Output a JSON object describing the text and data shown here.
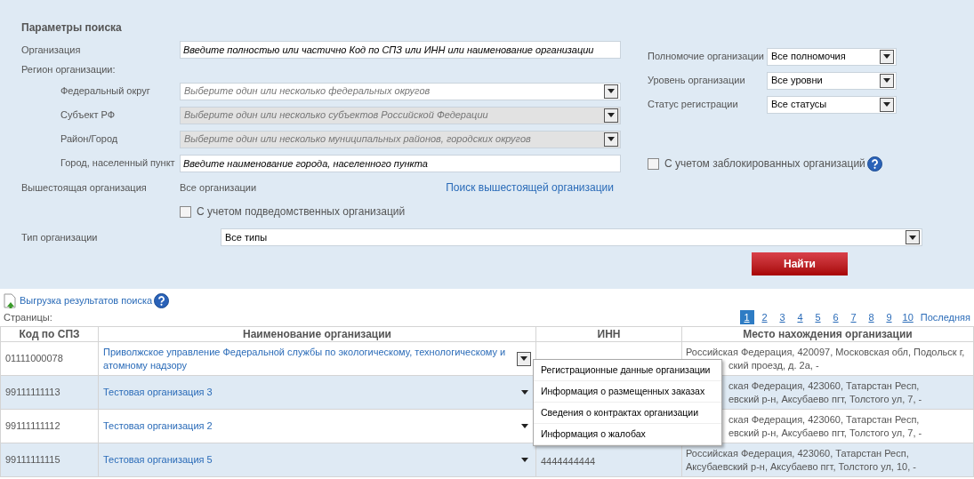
{
  "search_panel": {
    "title": "Параметры поиска",
    "organization": {
      "label": "Организация",
      "placeholder": "Введите полностью или частично Код по СПЗ или ИНН или наименование организации"
    },
    "region_label": "Регион организации:",
    "region_fields": [
      {
        "label": "Федеральный округ",
        "placeholder": "Выберите один или несколько федеральных округов",
        "disabled": false
      },
      {
        "label": "Субъект РФ",
        "placeholder": "Выберите один или несколько субъектов Российской Федерации",
        "disabled": true
      },
      {
        "label": "Район/Город",
        "placeholder": "Выберите один или несколько муниципальных районов, городских округов",
        "disabled": true
      }
    ],
    "city": {
      "label": "Город, населенный пункт",
      "placeholder": "Введите наименование города, населенного пункта"
    },
    "parent": {
      "label": "Вышестоящая организация",
      "value": "Все организации",
      "link": "Поиск вышестоящей организации"
    },
    "include_subordinate": {
      "label": "С учетом подведомственных организаций",
      "checked": false
    },
    "right_selects": [
      {
        "label": "Полномочие организации",
        "value": "Все полномочия"
      },
      {
        "label": "Уровень организации",
        "value": "Все уровни"
      },
      {
        "label": "Статус регистрации",
        "value": "Все статусы"
      }
    ],
    "include_blocked": {
      "label": "С учетом заблокированных организаций",
      "checked": false
    },
    "org_type": {
      "label": "Тип организации",
      "value": "Все типы"
    },
    "search_button": "Найти"
  },
  "export_link": "Выгрузка результатов поиска",
  "pages_label": "Страницы:",
  "pages": [
    {
      "label": "1",
      "selected": true
    },
    {
      "label": "2",
      "selected": false
    },
    {
      "label": "3",
      "selected": false
    },
    {
      "label": "4",
      "selected": false
    },
    {
      "label": "5",
      "selected": false
    },
    {
      "label": "6",
      "selected": false
    },
    {
      "label": "7",
      "selected": false
    },
    {
      "label": "8",
      "selected": false
    },
    {
      "label": "9",
      "selected": false
    },
    {
      "label": "10",
      "selected": false
    }
  ],
  "last_page": "Последняя",
  "table": {
    "columns": [
      "Код по СПЗ",
      "Наименование организации",
      "ИНН",
      "Место нахождения организации"
    ],
    "rows": [
      {
        "code": "01111000078",
        "name": "Приволжское управление Федеральной службы по экологическому, технологическому и атомному надзору",
        "address": [
          "Российская Федерация, 420097, Московская обл, Подольск г,",
          "ский проезд, д. 2а, -"
        ],
        "menu_open": true
      },
      {
        "code": "99111111113",
        "name": "Тестовая организация 3",
        "address": [
          "ская Федерация, 423060, Татарстан Респ,",
          "евский р-н, Аксубаево пгт, Толстого ул, 7, -"
        ],
        "menu_open": false
      },
      {
        "code": "99111111112",
        "name": "Тестовая организация 2",
        "address": [
          "ская Федерация, 423060, Татарстан Респ,",
          "евский р-н, Аксубаево пгт, Толстого ул, 7, -"
        ],
        "menu_open": false
      },
      {
        "code": "99111111115",
        "name": "Тестовая организация 5",
        "inn": "4444444444",
        "address": [
          "Российская Федерация, 423060, Татарстан Респ,",
          "Аксубаевский р-н, Аксубаево пгт, Толстого ул, 10, -"
        ],
        "menu_open": false
      }
    ]
  },
  "row_menu": [
    "Регистрационные данные организации",
    "Информация о размещенных заказах",
    "Сведения о контрактах организации",
    "Информация о жалобах"
  ]
}
